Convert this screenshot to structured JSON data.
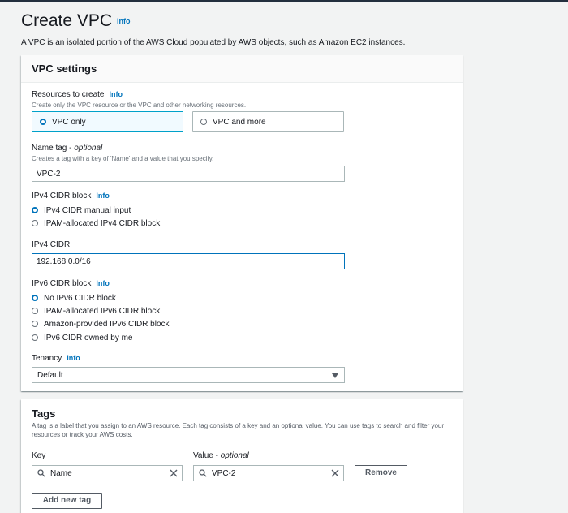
{
  "page": {
    "title": "Create VPC",
    "info": "Info",
    "description": "A VPC is an isolated portion of the AWS Cloud populated by AWS objects, such as Amazon EC2 instances."
  },
  "vpc_settings": {
    "title": "VPC settings",
    "resources": {
      "label": "Resources to create",
      "info": "Info",
      "description": "Create only the VPC resource or the VPC and other networking resources.",
      "options": [
        "VPC only",
        "VPC and more"
      ],
      "selected": "VPC only"
    },
    "name_tag": {
      "label": "Name tag - ",
      "label_optional": "optional",
      "description": "Creates a tag with a key of 'Name' and a value that you specify.",
      "value": "VPC-2"
    },
    "ipv4_block": {
      "label": "IPv4 CIDR block",
      "info": "Info",
      "options": [
        "IPv4 CIDR manual input",
        "IPAM-allocated IPv4 CIDR block"
      ],
      "selected": "IPv4 CIDR manual input"
    },
    "ipv4_cidr": {
      "label": "IPv4 CIDR",
      "value": "192.168.0.0/16"
    },
    "ipv6_block": {
      "label": "IPv6 CIDR block",
      "info": "Info",
      "options": [
        "No IPv6 CIDR block",
        "IPAM-allocated IPv6 CIDR block",
        "Amazon-provided IPv6 CIDR block",
        "IPv6 CIDR owned by me"
      ],
      "selected": "No IPv6 CIDR block"
    },
    "tenancy": {
      "label": "Tenancy",
      "info": "Info",
      "value": "Default"
    }
  },
  "tags": {
    "title": "Tags",
    "description": "A tag is a label that you assign to an AWS resource. Each tag consists of a key and an optional value. You can use tags to search and filter your resources or track your AWS costs.",
    "key_label": "Key",
    "value_label": "Value - ",
    "value_label_optional": "optional",
    "rows": [
      {
        "key": "Name",
        "value": "VPC-2",
        "remove_label": "Remove"
      }
    ],
    "add_label": "Add new tag"
  },
  "colors": {
    "link": "#0073bb",
    "selected_tile_bg": "#f1faff",
    "selected_tile_border": "#00a1c9",
    "page_bg": "#f2f3f3"
  },
  "icons": {
    "search": "search-icon",
    "clear": "close-icon",
    "dropdown": "caret-down-icon"
  }
}
